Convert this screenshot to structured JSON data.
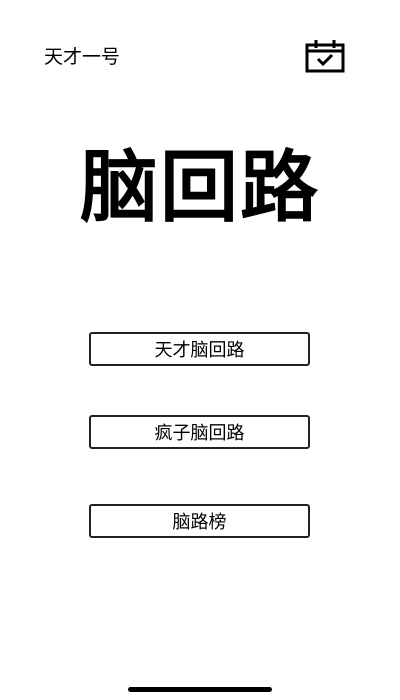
{
  "header": {
    "title": "天才一号",
    "calendar_icon": "calendar-check-icon"
  },
  "logo": {
    "text": "脑回路"
  },
  "menu": {
    "items": [
      {
        "label": "天才脑回路"
      },
      {
        "label": "疯子脑回路"
      },
      {
        "label": "脑路榜"
      }
    ]
  },
  "colors": {
    "background": "#ffffff",
    "text": "#000000",
    "border": "#222222"
  }
}
